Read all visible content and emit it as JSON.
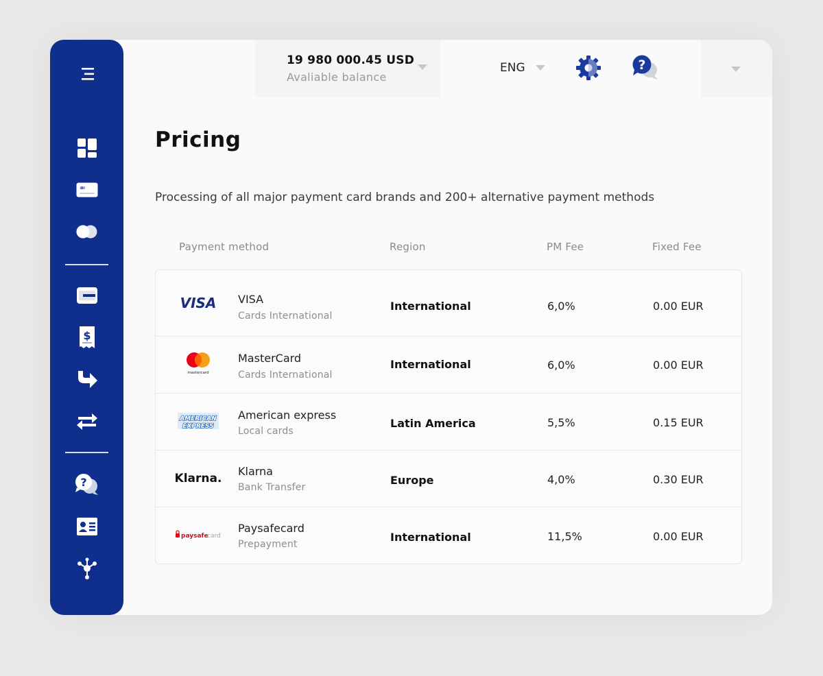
{
  "header": {
    "balance_amount": "19 980 000.45 USD",
    "balance_label": "Avaliable balance",
    "language": "ENG"
  },
  "sidebar": {
    "icons": [
      "menu-icon",
      "dashboard-icon",
      "card-icon",
      "card-brands-icon",
      "wallet-icon",
      "invoice-icon",
      "redirect-icon",
      "transfer-icon",
      "support-icon",
      "id-card-icon",
      "network-icon"
    ]
  },
  "page": {
    "title": "Pricing",
    "subtitle": "Processing of all major payment card brands and 200+ alternative payment methods"
  },
  "table": {
    "headers": {
      "payment_method": "Payment method",
      "region": "Region",
      "pm_fee": "PM Fee",
      "fixed_fee": "Fixed Fee"
    },
    "rows": [
      {
        "logo": "visa",
        "logo_text": "VISA",
        "name": "VISA",
        "sub": "Cards International",
        "region": "International",
        "pm_fee": "6,0%",
        "fixed_fee": "0.00 EUR"
      },
      {
        "logo": "mastercard",
        "logo_text": "mastercard",
        "name": "MasterCard",
        "sub": "Cards International",
        "region": "International",
        "pm_fee": "6,0%",
        "fixed_fee": "0.00 EUR"
      },
      {
        "logo": "amex",
        "logo_text": "AMERICAN EXPRESS",
        "name": "American express",
        "sub": "Local cards",
        "region": "Latin America",
        "pm_fee": "5,5%",
        "fixed_fee": "0.15 EUR"
      },
      {
        "logo": "klarna",
        "logo_text": "Klarna.",
        "name": "Klarna",
        "sub": "Bank Transfer",
        "region": "Europe",
        "pm_fee": "4,0%",
        "fixed_fee": "0.30 EUR"
      },
      {
        "logo": "paysafecard",
        "logo_text": "paysafecard",
        "name": "Paysafecard",
        "sub": "Prepayment",
        "region": "International",
        "pm_fee": "11,5%",
        "fixed_fee": "0.00 EUR"
      }
    ]
  },
  "colors": {
    "sidebar": "#102f8c",
    "accent": "#1a3aa0",
    "background": "#fafafa"
  }
}
